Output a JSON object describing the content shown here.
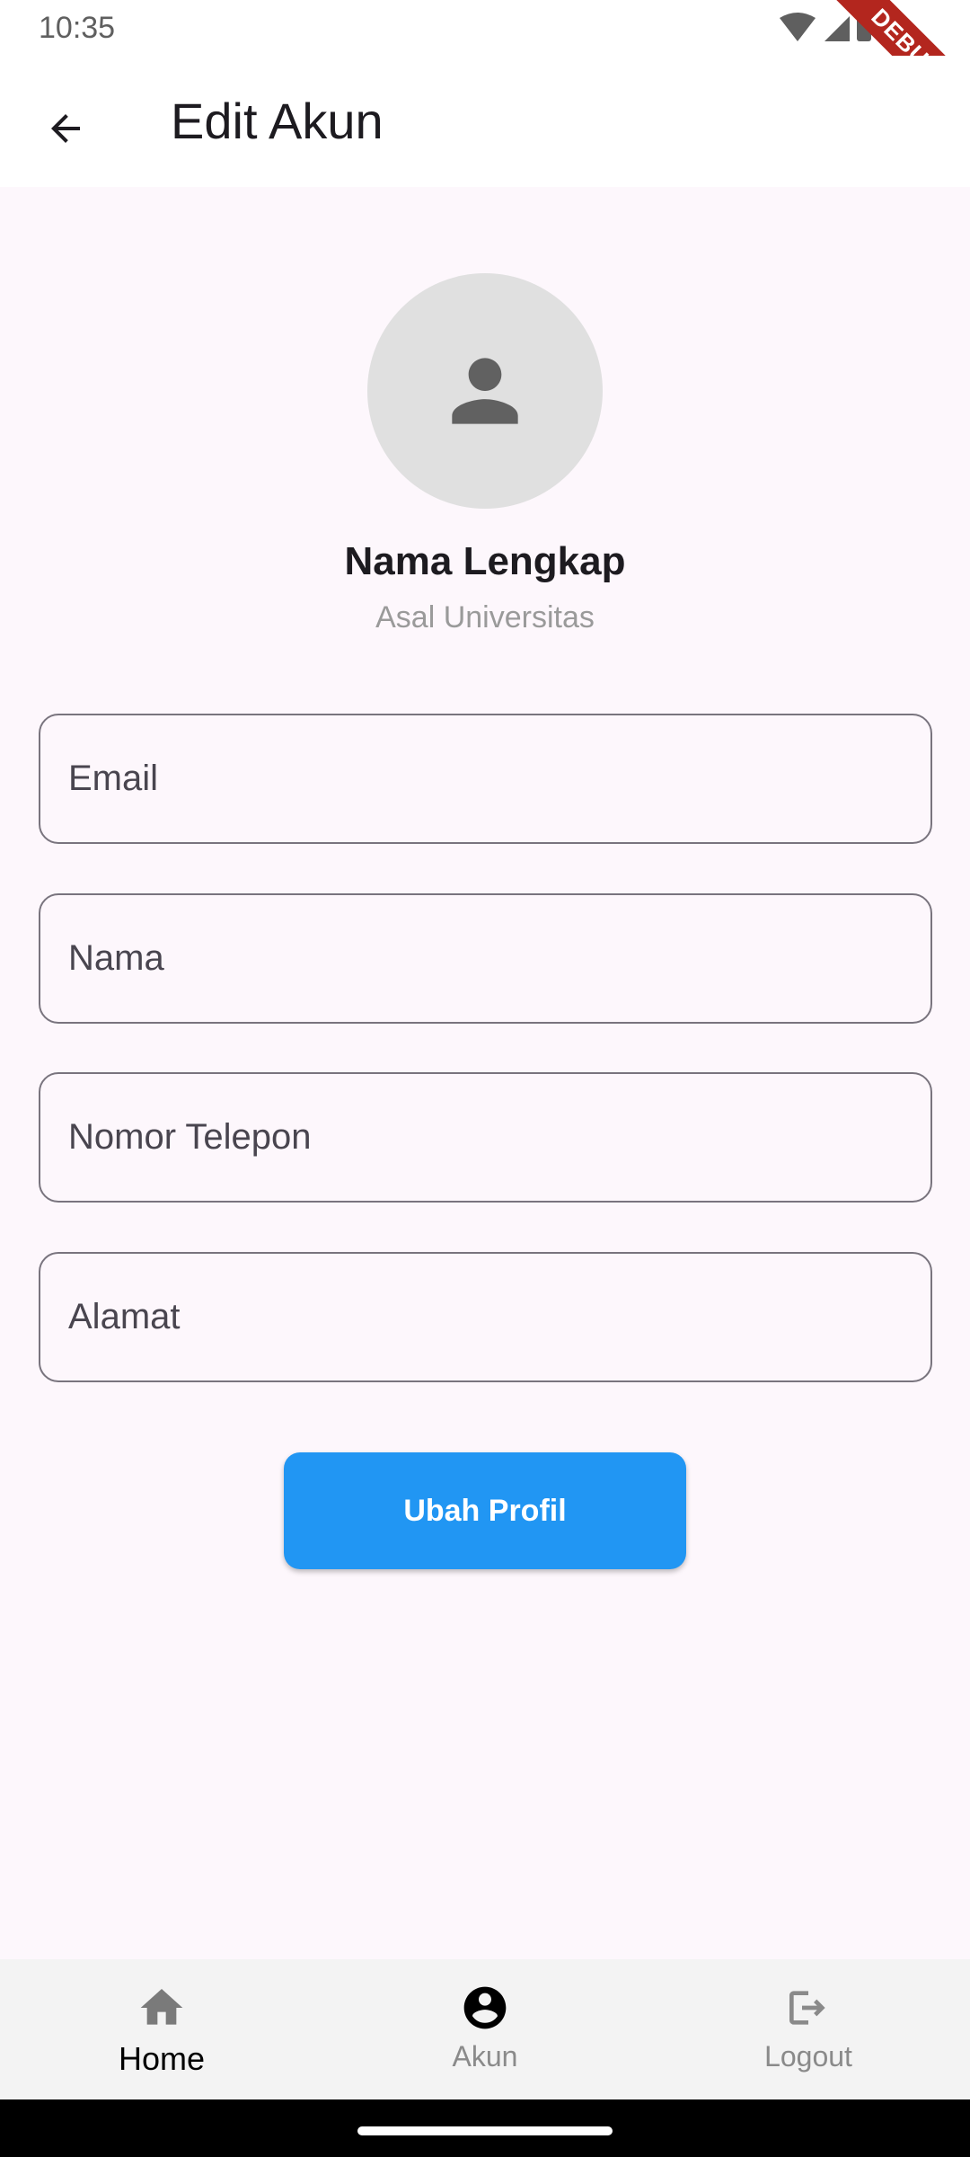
{
  "status_bar": {
    "time": "10:35",
    "debug_label": "DEBUG"
  },
  "app_bar": {
    "title": "Edit Akun",
    "back_icon": "arrow-back-icon"
  },
  "profile": {
    "name": "Nama Lengkap",
    "university": "Asal Universitas",
    "avatar_icon": "person-icon"
  },
  "form": {
    "fields": [
      {
        "label": "Email"
      },
      {
        "label": "Nama"
      },
      {
        "label": "Nomor Telepon"
      },
      {
        "label": "Alamat"
      }
    ],
    "submit_label": "Ubah Profil"
  },
  "bottom_nav": {
    "items": [
      {
        "label": "Home",
        "icon": "home-icon",
        "active": true
      },
      {
        "label": "Akun",
        "icon": "account-circle-icon",
        "active": false
      },
      {
        "label": "Logout",
        "icon": "logout-icon",
        "active": false
      }
    ]
  },
  "colors": {
    "accent": "#2196f3",
    "background": "#fdf7fc",
    "nav_background": "#f3f3f3"
  }
}
